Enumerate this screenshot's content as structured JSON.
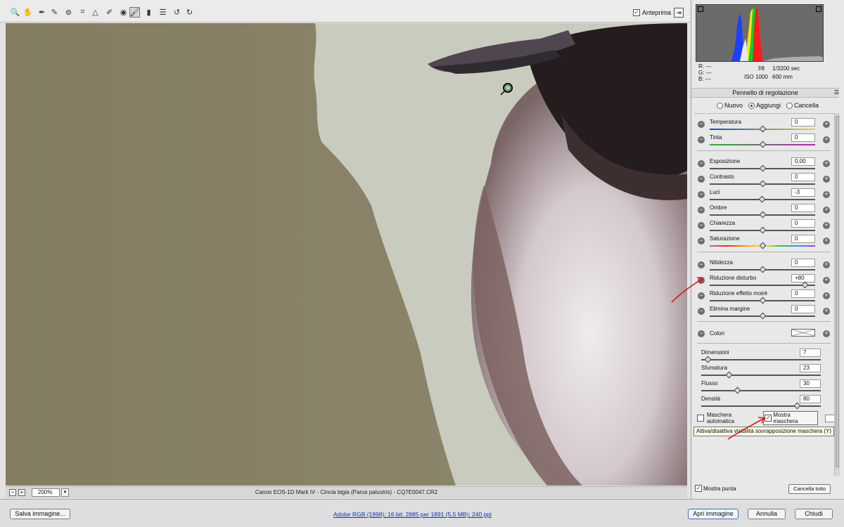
{
  "toolbar": {
    "tools": [
      {
        "name": "zoom-tool",
        "icon": "🔍"
      },
      {
        "name": "hand-tool",
        "icon": "✋"
      },
      {
        "name": "white-balance-tool",
        "icon": "✒"
      },
      {
        "name": "color-sampler-tool",
        "icon": "✎"
      },
      {
        "name": "targeted-adjustment-tool",
        "icon": "⊚"
      },
      {
        "name": "crop-tool",
        "icon": "⌗"
      },
      {
        "name": "straighten-tool",
        "icon": "△"
      },
      {
        "name": "spot-removal-tool",
        "icon": "✐"
      },
      {
        "name": "red-eye-tool",
        "icon": "◉"
      },
      {
        "name": "adjustment-brush-tool",
        "icon": "🖌"
      },
      {
        "name": "graduated-filter-tool",
        "icon": "▮"
      },
      {
        "name": "preferences-tool",
        "icon": "☰"
      },
      {
        "name": "rotate-left-tool",
        "icon": "↺"
      },
      {
        "name": "rotate-right-tool",
        "icon": "↻"
      }
    ],
    "preview_label": "Anteprima",
    "preview_checked": true
  },
  "canvas": {
    "zoom": "200%",
    "filename": "Canon EOS-1D Mark IV  -  Cincia bigia (Parus palustris)  -  CQ7E0047.CR2"
  },
  "info": {
    "r_label": "R:",
    "r_value": "---",
    "g_label": "G:",
    "g_value": "---",
    "b_label": "B:",
    "b_value": "---",
    "aperture": "f/8",
    "shutter": "1/3200 sec",
    "iso": "ISO 1000",
    "focal": "600 mm"
  },
  "panel": {
    "title": "Pennello di regolazione",
    "mode_options": [
      "Nuovo",
      "Aggiungi",
      "Cancella"
    ],
    "mode_selected": "Aggiungi"
  },
  "sliders": [
    {
      "label": "Temperatura",
      "value": "0",
      "pos": 0.5
    },
    {
      "label": "Tinta",
      "value": "0",
      "pos": 0.5
    },
    {
      "label": "Esposizione",
      "value": "0,00",
      "pos": 0.5
    },
    {
      "label": "Contrasto",
      "value": "0",
      "pos": 0.5
    },
    {
      "label": "Luci",
      "value": "-3",
      "pos": 0.49
    },
    {
      "label": "Ombre",
      "value": "0",
      "pos": 0.5
    },
    {
      "label": "Chiarezza",
      "value": "0",
      "pos": 0.5
    },
    {
      "label": "Saturazione",
      "value": "0",
      "pos": 0.5
    },
    {
      "label": "Nitidezza",
      "value": "0",
      "pos": 0.5
    },
    {
      "label": "Riduzione disturbo",
      "value": "+80",
      "pos": 0.9
    },
    {
      "label": "Riduzione effetto moiré",
      "value": "0",
      "pos": 0.5
    },
    {
      "label": "Elimina margine",
      "value": "0",
      "pos": 0.5
    }
  ],
  "colors_label": "Colori",
  "brush": [
    {
      "label": "Dimensioni",
      "value": "7",
      "pos": 0.05
    },
    {
      "label": "Sfumatura",
      "value": "23",
      "pos": 0.23
    },
    {
      "label": "Flusso",
      "value": "30",
      "pos": 0.3
    },
    {
      "label": "Densità",
      "value": "80",
      "pos": 0.8
    }
  ],
  "mask": {
    "auto_mask_label": "Maschera automatica",
    "auto_mask_checked": false,
    "show_mask_label": "Mostra maschera",
    "show_mask_checked": true,
    "tooltip": "Attiva/disattiva visibilità sovrapposizione maschera (Y)"
  },
  "footer_panel": {
    "show_pin_label": "Mostra punta",
    "show_pin_checked": true,
    "clear_all_label": "Cancella tutto"
  },
  "bottom": {
    "save_label": "Salva immagine...",
    "workflow_text": "Adobe RGB (1998); 16 bit; 2885 per 1891 (5,5 MB); 240 ppi",
    "open_label": "Apri immagine",
    "cancel_label": "Annulla",
    "done_label": "Chiudi"
  },
  "colors": {
    "accent": "#3d6fb2",
    "annotation_red": "#d21b1b"
  }
}
